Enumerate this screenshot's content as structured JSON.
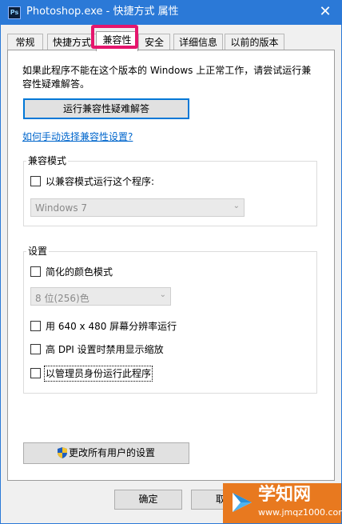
{
  "window": {
    "title": "Photoshop.exe - 快捷方式 属性",
    "app_icon_text": "Ps",
    "close_glyph": "✕"
  },
  "tabs": [
    {
      "label": "常规"
    },
    {
      "label": "快捷方式"
    },
    {
      "label": "兼容性",
      "active": true
    },
    {
      "label": "安全"
    },
    {
      "label": "详细信息"
    },
    {
      "label": "以前的版本"
    }
  ],
  "compat": {
    "description": "如果此程序不能在这个版本的 Windows 上正常工作，请尝试运行兼容性疑难解答。",
    "troubleshoot_button": "运行兼容性疑难解答",
    "manual_link": "如何手动选择兼容性设置?"
  },
  "compat_mode": {
    "group_label": "兼容模式",
    "checkbox_label": "以兼容模式运行这个程序:",
    "os_selected": "Windows 7"
  },
  "settings": {
    "group_label": "设置",
    "reduced_color": "简化的颜色模式",
    "color_selected": "8 位(256)色",
    "res_640": "用 640 x 480 屏幕分辨率运行",
    "high_dpi": "高 DPI 设置时禁用显示缩放",
    "run_as_admin": "以管理员身份运行此程序"
  },
  "all_users_button": "更改所有用户的设置",
  "footer": {
    "ok": "确定",
    "cancel_partial": "取"
  },
  "watermark": {
    "name": "学知网",
    "url": "www.jmqz1000.com"
  },
  "icons": {
    "shield": "uac-shield-icon",
    "dropdown": "chevron-down-icon"
  }
}
